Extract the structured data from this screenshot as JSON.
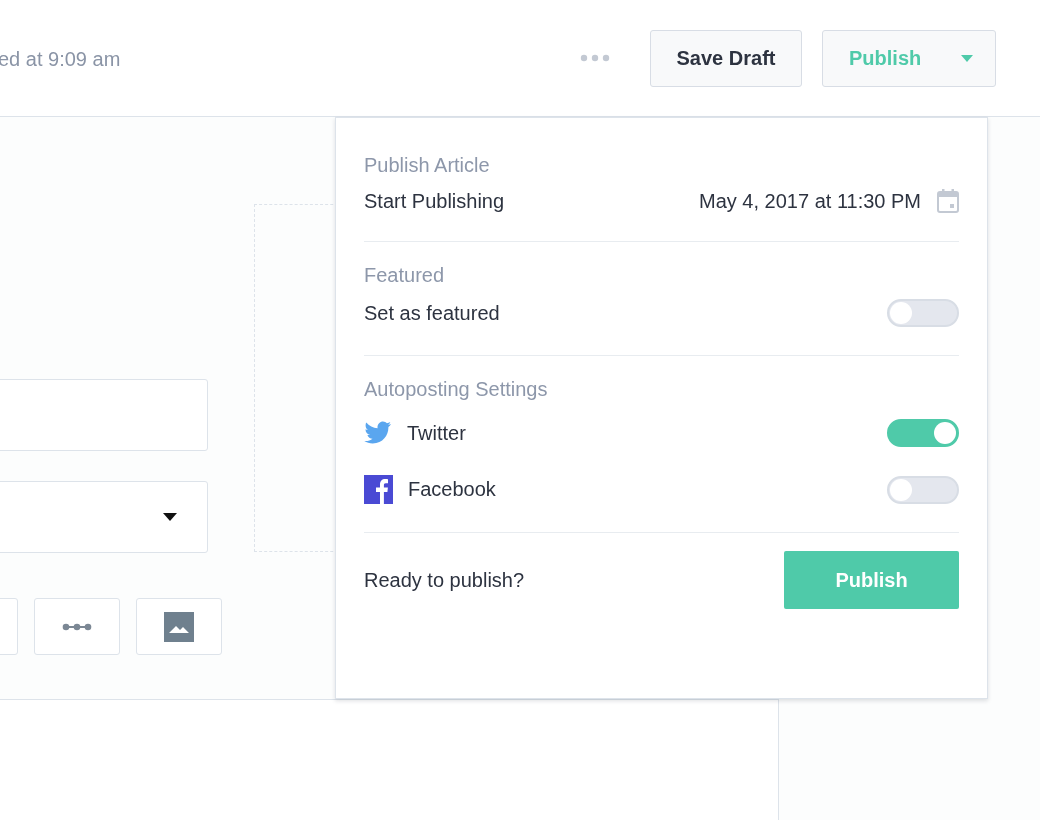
{
  "header": {
    "status": "ed at 9:09 am",
    "save_draft": "Save Draft",
    "publish": "Publish"
  },
  "popover": {
    "schedule": {
      "title": "Publish Article",
      "label": "Start Publishing",
      "value": "May 4, 2017 at 11:30 PM"
    },
    "featured": {
      "title": "Featured",
      "label": "Set as featured",
      "on": false
    },
    "autoposting": {
      "title": "Autoposting Settings",
      "items": [
        {
          "kind": "twitter",
          "label": "Twitter",
          "on": true
        },
        {
          "kind": "facebook",
          "label": "Facebook",
          "on": false
        }
      ]
    },
    "footer": {
      "prompt": "Ready to publish?",
      "button": "Publish"
    }
  }
}
